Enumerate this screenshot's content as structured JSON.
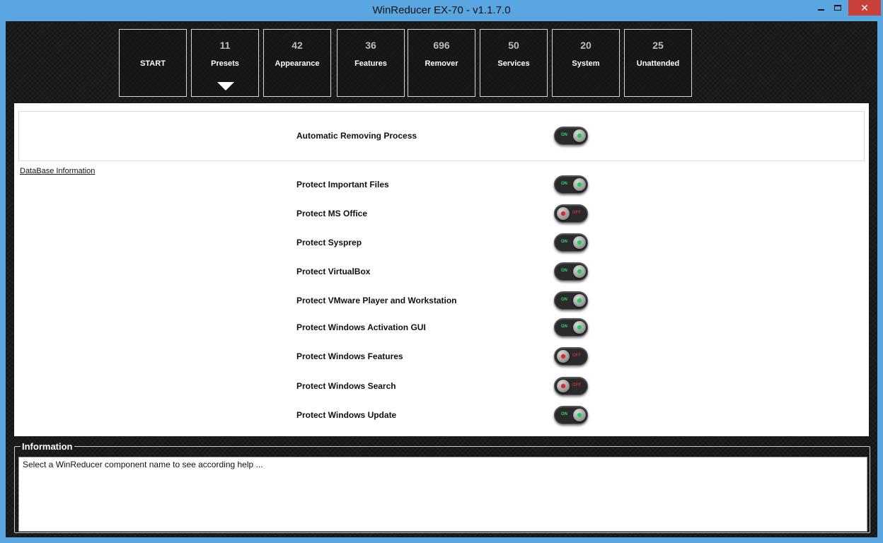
{
  "window": {
    "title": "WinReducer EX-70 - v1.1.7.0",
    "close_symbol": "✕"
  },
  "tiles": [
    {
      "count": "",
      "label": "START",
      "selected": false
    },
    {
      "count": "11",
      "label": "Presets",
      "selected": true
    },
    {
      "count": "42",
      "label": "Appearance",
      "selected": false
    },
    {
      "count": "36",
      "label": "Features",
      "selected": false
    },
    {
      "count": "696",
      "label": "Remover",
      "selected": false
    },
    {
      "count": "50",
      "label": "Services",
      "selected": false
    },
    {
      "count": "20",
      "label": "System",
      "selected": false
    },
    {
      "count": "25",
      "label": "Unattended",
      "selected": false
    }
  ],
  "panel": {
    "auto_label": "Automatic Removing Process",
    "auto_state": "on",
    "database_link": "DataBase Information",
    "toggle_on_text": "ON",
    "toggle_off_text": "OFF",
    "options": [
      {
        "label": "Protect Important Files",
        "state": "on"
      },
      {
        "label": "Protect MS Office",
        "state": "off"
      },
      {
        "label": "Protect Sysprep",
        "state": "on"
      },
      {
        "label": "Protect VirtualBox",
        "state": "on"
      },
      {
        "label": "Protect VMware Player and Workstation",
        "state": "on"
      },
      {
        "label": "Protect Windows Activation GUI",
        "state": "on"
      },
      {
        "label": "Protect Windows Features",
        "state": "off"
      },
      {
        "label": "Protect Windows Search",
        "state": "off"
      },
      {
        "label": "Protect Windows Update",
        "state": "on"
      }
    ]
  },
  "information": {
    "title": "Information",
    "text": "Select a WinReducer component name to see according help ..."
  },
  "colors": {
    "titlebar": "#5aa6e0",
    "background": "#1b1b1b",
    "toggle_on": "#29c45a",
    "toggle_off": "#c83030"
  }
}
